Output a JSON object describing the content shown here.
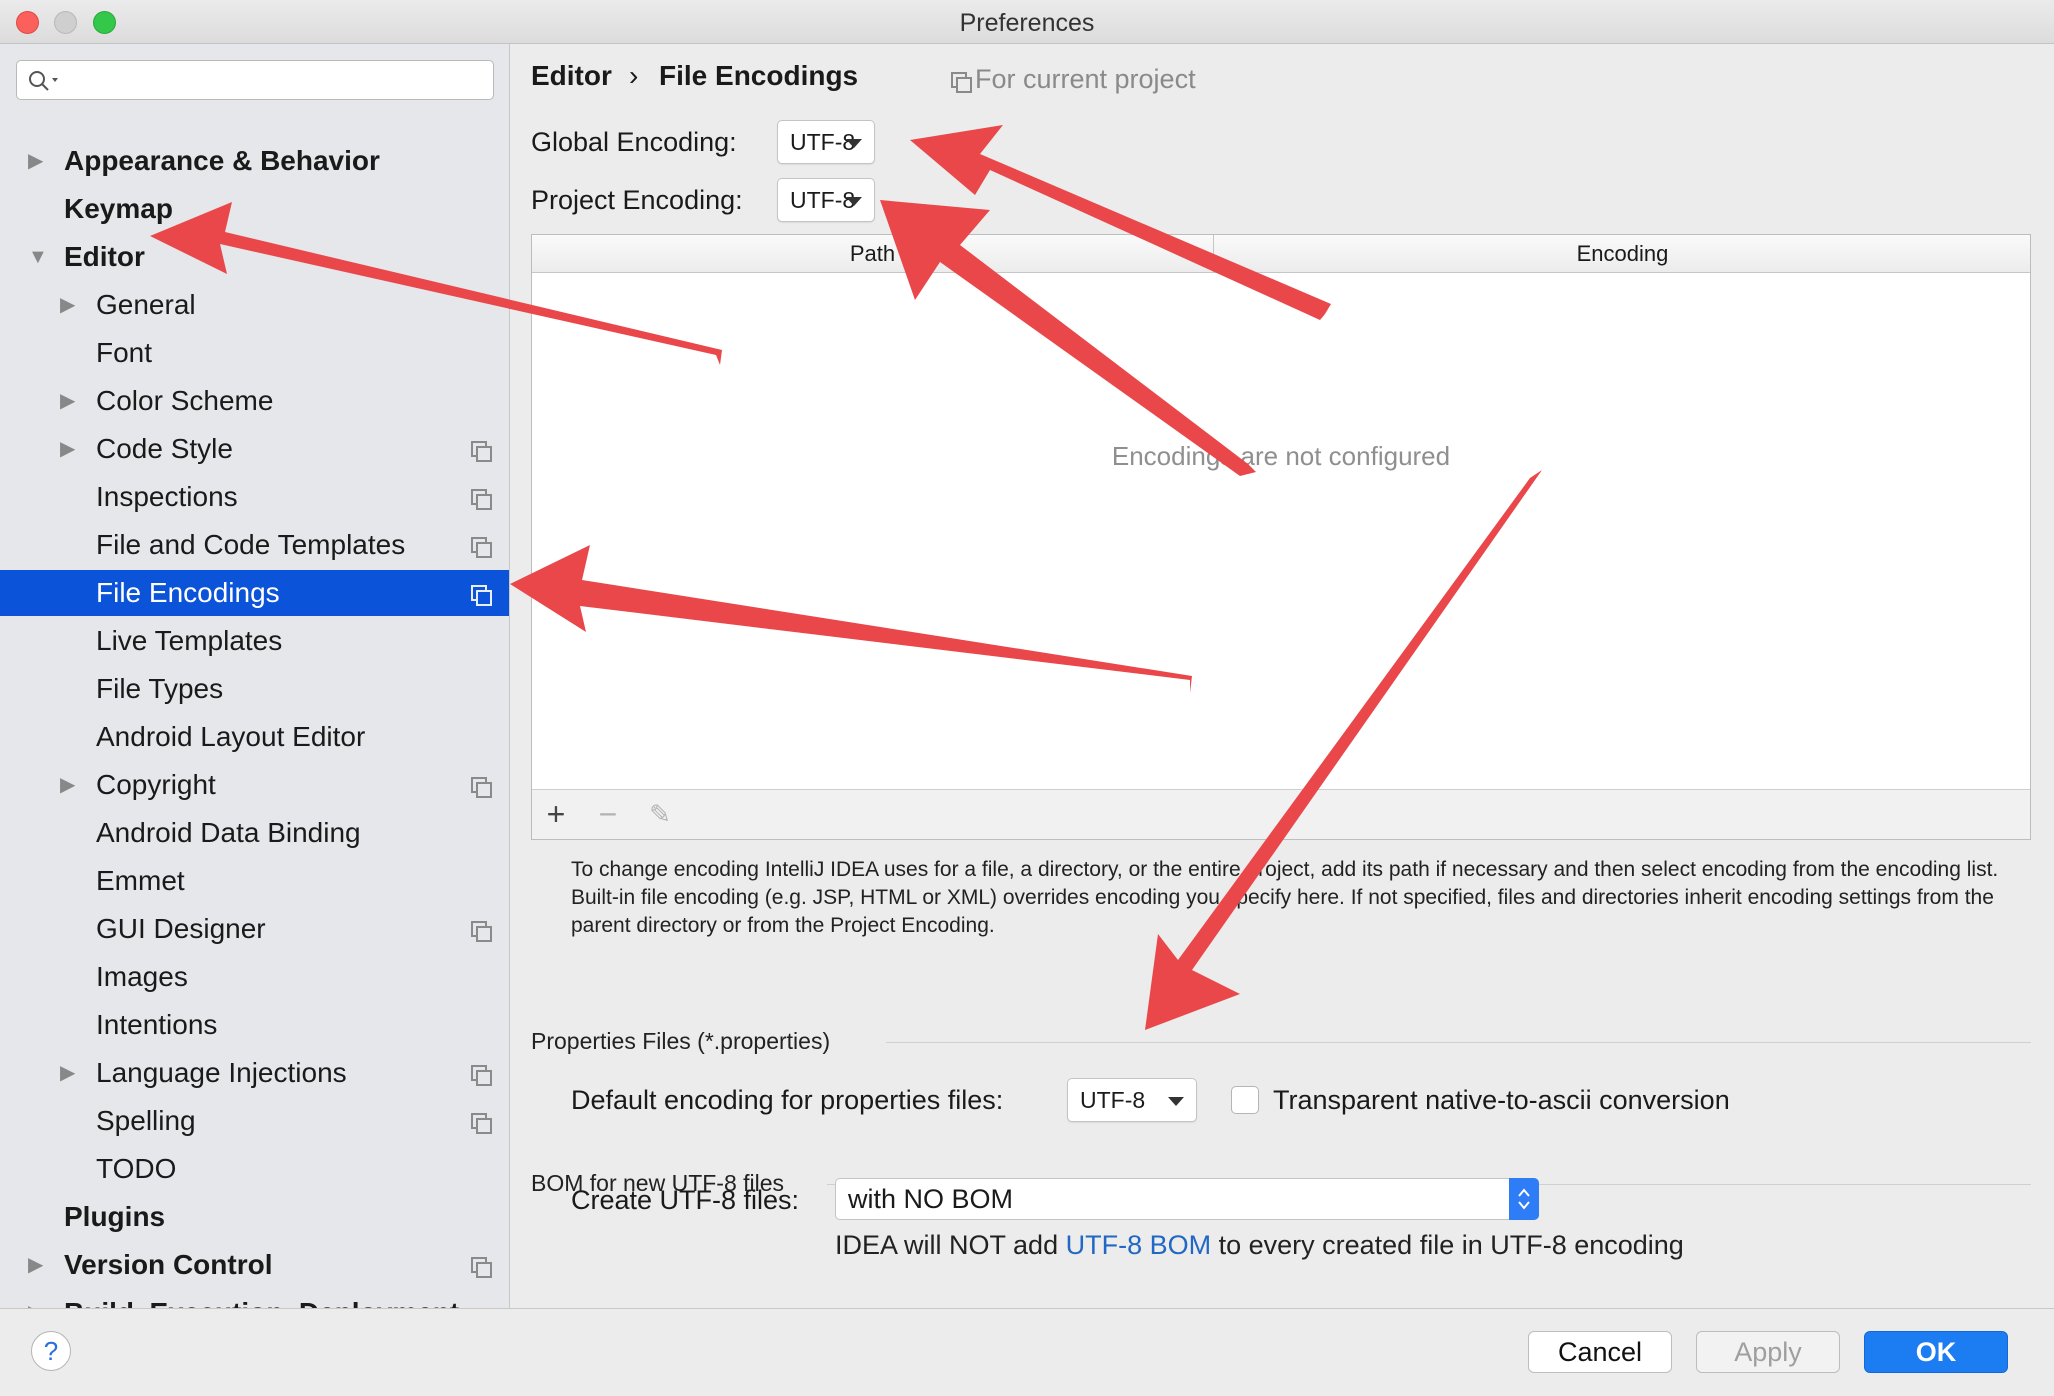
{
  "window": {
    "title": "Preferences"
  },
  "sidebar": {
    "search_placeholder": "",
    "items": [
      {
        "label": "Appearance & Behavior",
        "level": 0,
        "arrow": "▶",
        "copy": false,
        "selected": false
      },
      {
        "label": "Keymap",
        "level": 0,
        "arrow": "",
        "copy": false,
        "selected": false
      },
      {
        "label": "Editor",
        "level": 0,
        "arrow": "▼",
        "copy": false,
        "selected": false
      },
      {
        "label": "General",
        "level": 1,
        "arrow": "▶",
        "copy": false,
        "selected": false
      },
      {
        "label": "Font",
        "level": 1,
        "arrow": "",
        "copy": false,
        "selected": false
      },
      {
        "label": "Color Scheme",
        "level": 1,
        "arrow": "▶",
        "copy": false,
        "selected": false
      },
      {
        "label": "Code Style",
        "level": 1,
        "arrow": "▶",
        "copy": true,
        "selected": false
      },
      {
        "label": "Inspections",
        "level": 1,
        "arrow": "",
        "copy": true,
        "selected": false
      },
      {
        "label": "File and Code Templates",
        "level": 1,
        "arrow": "",
        "copy": true,
        "selected": false
      },
      {
        "label": "File Encodings",
        "level": 1,
        "arrow": "",
        "copy": true,
        "selected": true
      },
      {
        "label": "Live Templates",
        "level": 1,
        "arrow": "",
        "copy": false,
        "selected": false
      },
      {
        "label": "File Types",
        "level": 1,
        "arrow": "",
        "copy": false,
        "selected": false
      },
      {
        "label": "Android Layout Editor",
        "level": 1,
        "arrow": "",
        "copy": false,
        "selected": false
      },
      {
        "label": "Copyright",
        "level": 1,
        "arrow": "▶",
        "copy": true,
        "selected": false
      },
      {
        "label": "Android Data Binding",
        "level": 1,
        "arrow": "",
        "copy": false,
        "selected": false
      },
      {
        "label": "Emmet",
        "level": 1,
        "arrow": "",
        "copy": false,
        "selected": false
      },
      {
        "label": "GUI Designer",
        "level": 1,
        "arrow": "",
        "copy": true,
        "selected": false
      },
      {
        "label": "Images",
        "level": 1,
        "arrow": "",
        "copy": false,
        "selected": false
      },
      {
        "label": "Intentions",
        "level": 1,
        "arrow": "",
        "copy": false,
        "selected": false
      },
      {
        "label": "Language Injections",
        "level": 1,
        "arrow": "▶",
        "copy": true,
        "selected": false
      },
      {
        "label": "Spelling",
        "level": 1,
        "arrow": "",
        "copy": true,
        "selected": false
      },
      {
        "label": "TODO",
        "level": 1,
        "arrow": "",
        "copy": false,
        "selected": false
      },
      {
        "label": "Plugins",
        "level": 0,
        "arrow": "",
        "copy": false,
        "selected": false
      },
      {
        "label": "Version Control",
        "level": 0,
        "arrow": "▶",
        "copy": true,
        "selected": false
      },
      {
        "label": "Build, Execution, Deployment",
        "level": 0,
        "arrow": "▶",
        "copy": false,
        "selected": false
      }
    ]
  },
  "header": {
    "crumb_parent": "Editor",
    "crumb_sep": "›",
    "crumb_current": "File Encodings",
    "scope": "For current project"
  },
  "encodings": {
    "global_label": "Global Encoding:",
    "global_value": "UTF-8",
    "project_label": "Project Encoding:",
    "project_value": "UTF-8"
  },
  "table": {
    "columns": [
      "Path",
      "Encoding"
    ],
    "empty_text": "Encodings are not configured",
    "toolbar": {
      "add": "+",
      "remove": "−",
      "edit": "✎"
    }
  },
  "help_text": "To change encoding IntelliJ IDEA uses for a file, a directory, or the entire project, add its path if necessary and then select encoding from the encoding list. Built-in file encoding (e.g. JSP, HTML or XML) overrides encoding you specify here. If not specified, files and directories inherit encoding settings from the parent directory or from the Project Encoding.",
  "properties": {
    "section_title": "Properties Files (*.properties)",
    "default_label": "Default encoding for properties files:",
    "default_value": "UTF-8",
    "transparent_label": "Transparent native-to-ascii conversion",
    "transparent_checked": false
  },
  "bom": {
    "section_title": "BOM for new UTF-8 files",
    "create_label": "Create UTF-8 files:",
    "create_value": "with NO BOM",
    "note_prefix": "IDEA will NOT add ",
    "note_link": "UTF-8 BOM",
    "note_suffix": " to every created file in UTF-8 encoding"
  },
  "footer": {
    "help": "?",
    "cancel": "Cancel",
    "apply": "Apply",
    "ok": "OK"
  },
  "colors": {
    "selection": "#0b53d8",
    "ok_button": "#1c7cf2",
    "annotation_arrow": "#e9474a",
    "link": "#2168c4"
  }
}
